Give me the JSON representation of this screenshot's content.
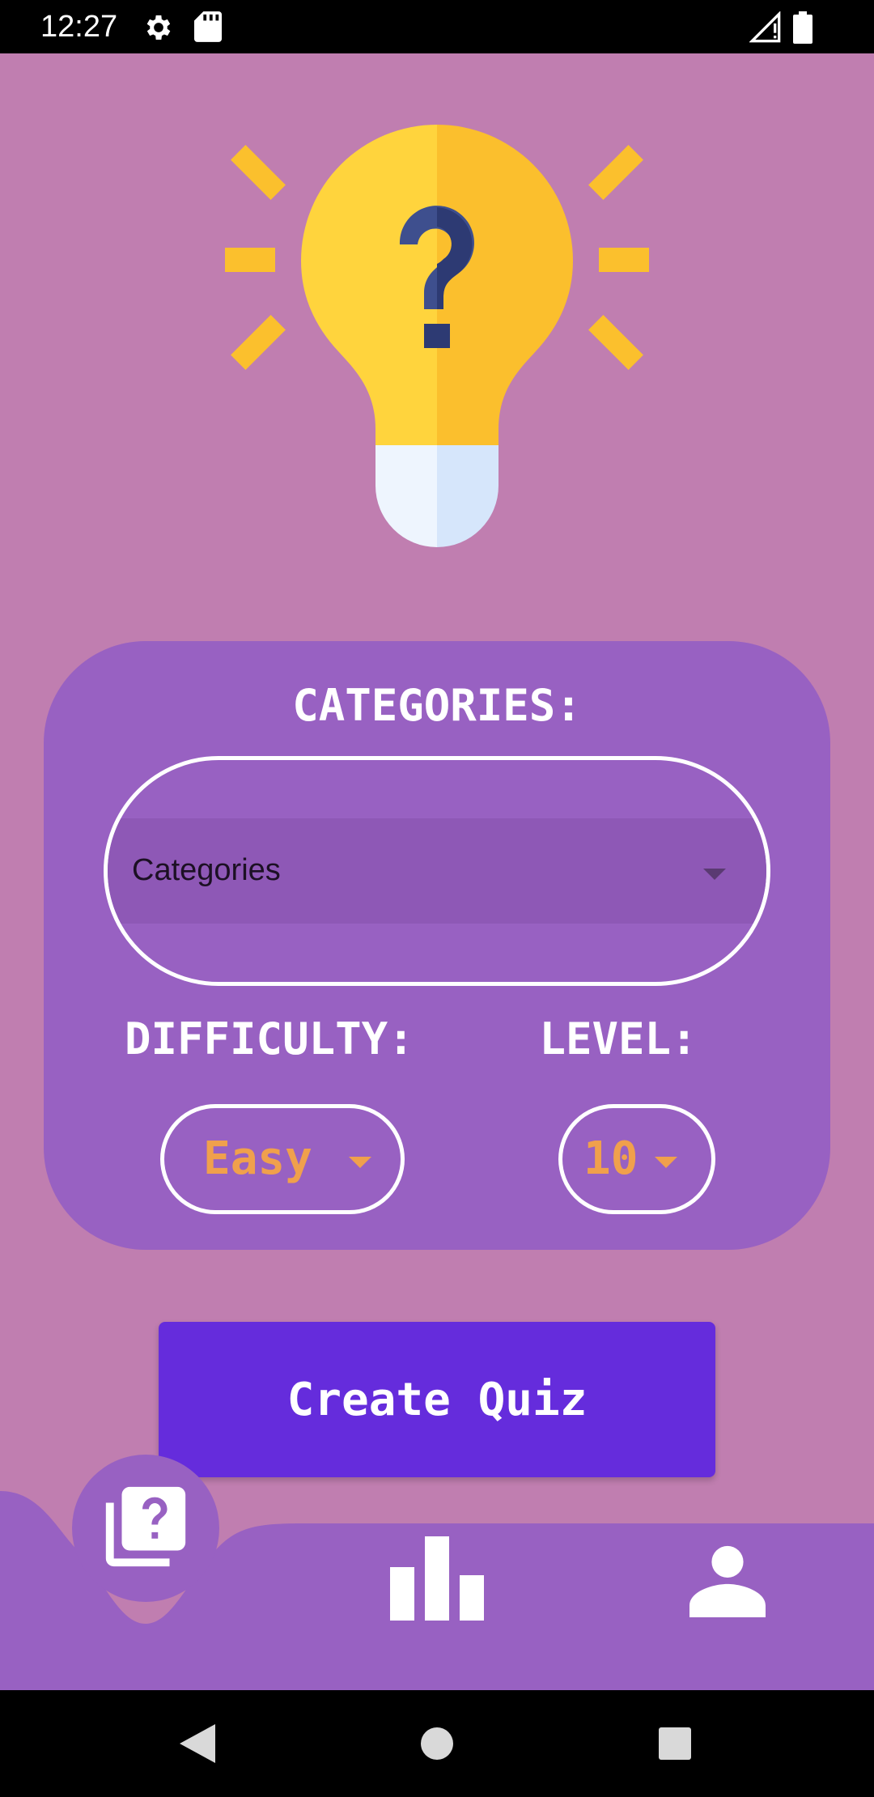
{
  "status_bar": {
    "time": "12:27",
    "icons": [
      "gear-icon",
      "sd-card-icon",
      "signal-icon",
      "battery-icon"
    ]
  },
  "hero": {
    "icon": "lightbulb-question-icon"
  },
  "form": {
    "categories_heading": "CATEGORIES:",
    "categories_value": "Categories",
    "difficulty_heading": "DIFFICULTY:",
    "difficulty_value": "Easy",
    "level_heading": "LEVEL:",
    "level_value": "10"
  },
  "actions": {
    "create_quiz_label": "Create Quiz"
  },
  "bottom_nav": {
    "items": [
      {
        "icon": "quiz-cards-icon",
        "active": true
      },
      {
        "icon": "bar-chart-icon",
        "active": false
      },
      {
        "icon": "person-icon",
        "active": false
      }
    ]
  },
  "system_nav": [
    "back-icon",
    "home-icon",
    "recents-icon"
  ],
  "colors": {
    "background": "#C07EB0",
    "card": "#9861C2",
    "accent": "#652CDC",
    "value_text": "#F0A04C"
  }
}
